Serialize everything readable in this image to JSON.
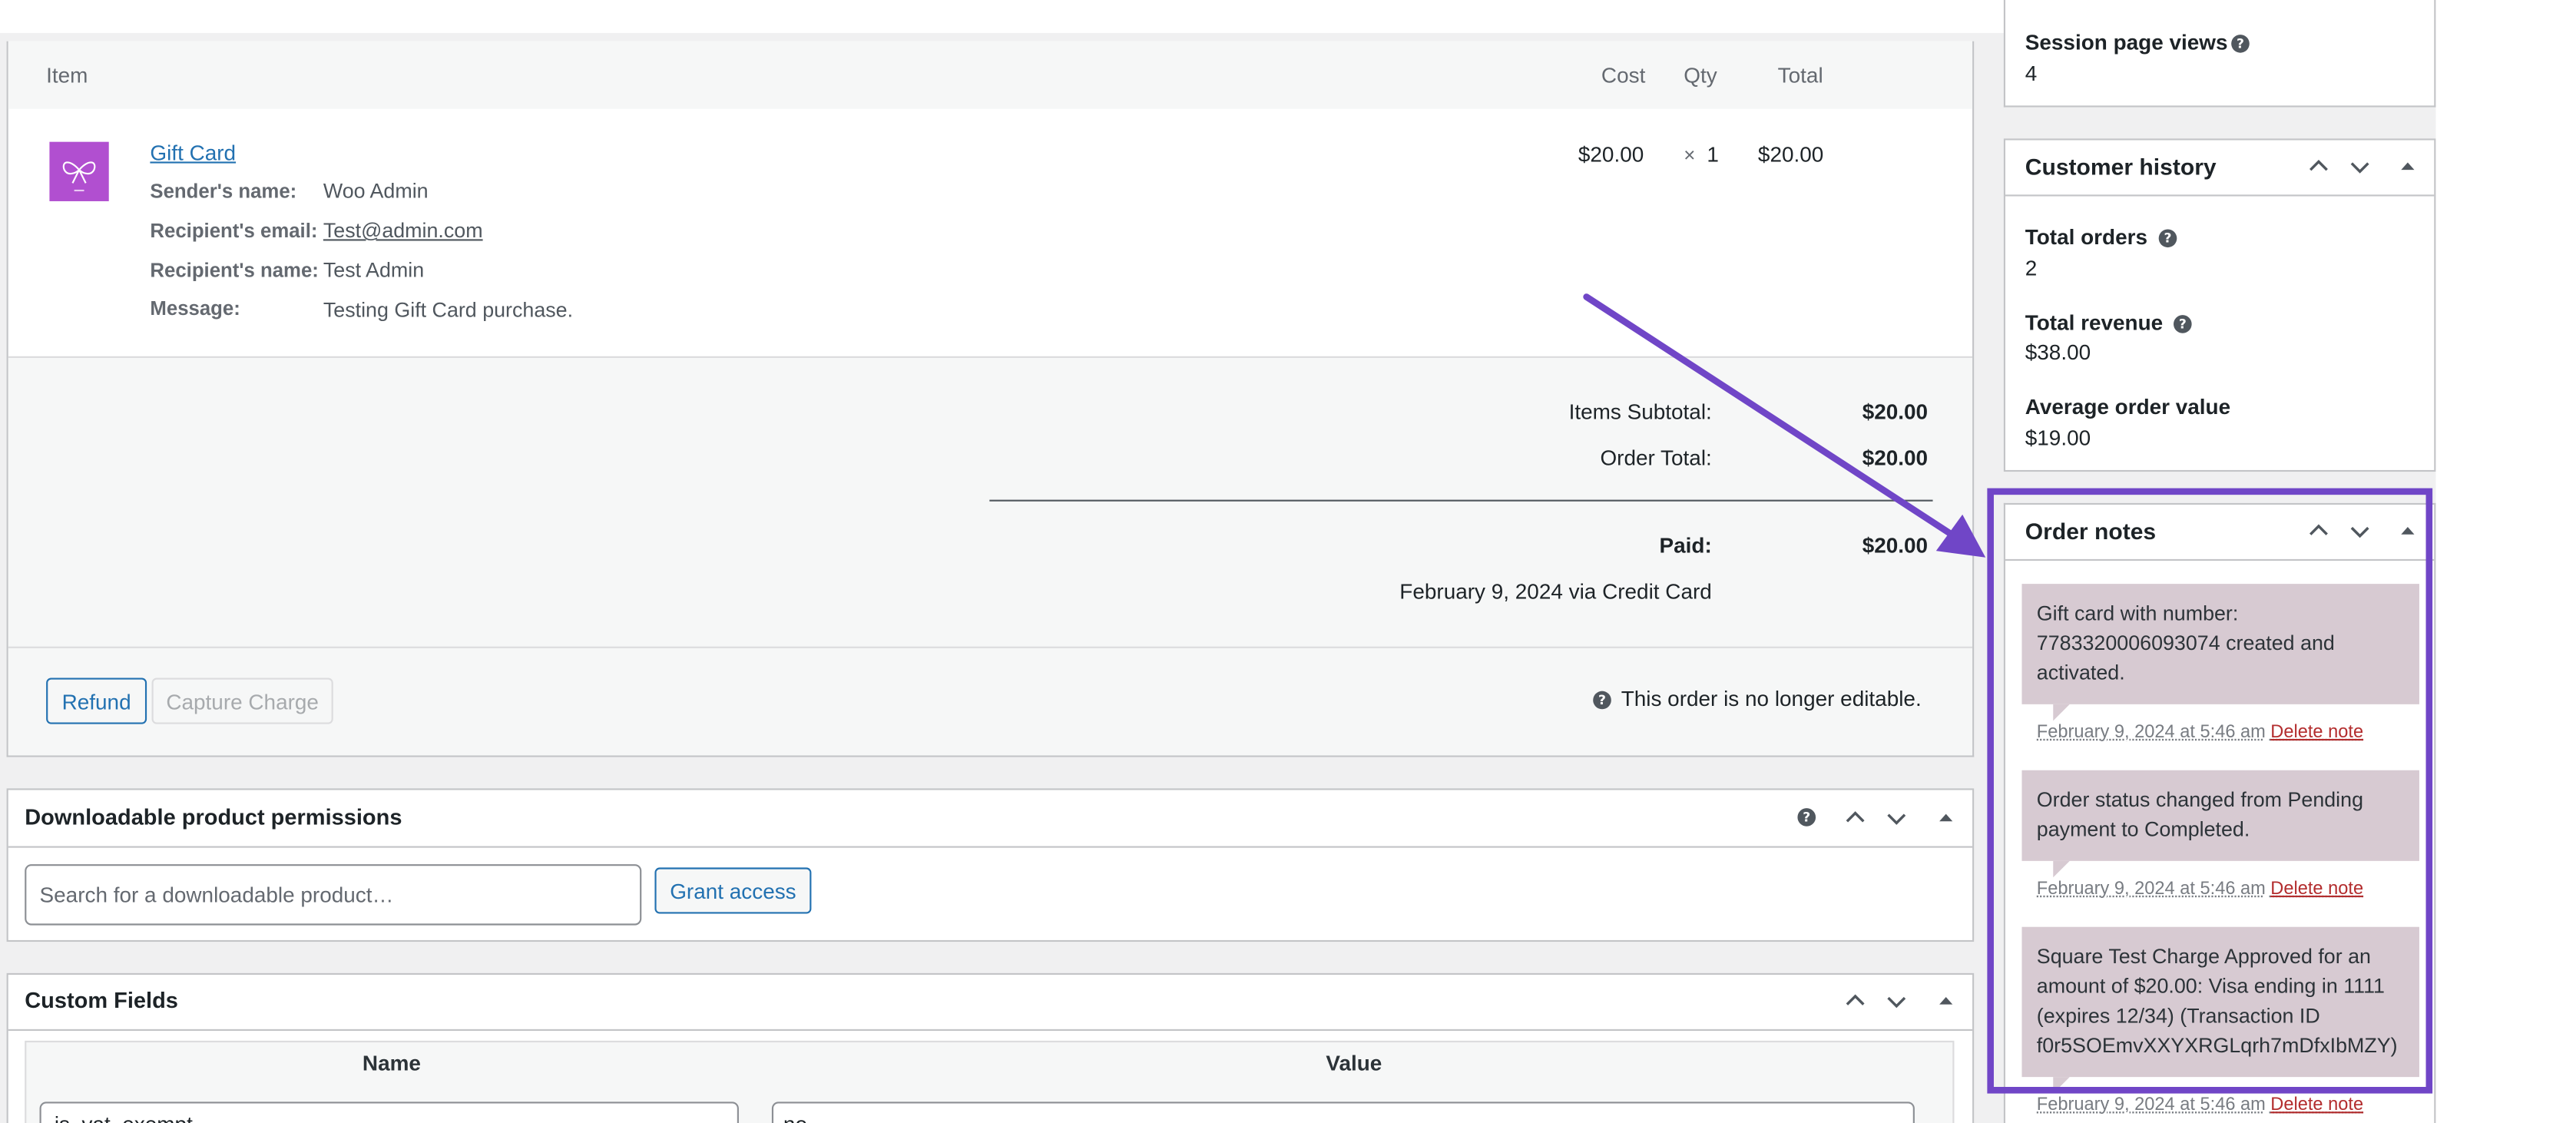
{
  "items_table": {
    "headers": {
      "item": "Item",
      "cost": "Cost",
      "qty": "Qty",
      "total": "Total"
    },
    "line_item": {
      "name": "Gift Card",
      "cost": "$20.00",
      "qty_symbol": "×",
      "qty": "1",
      "total": "$20.00",
      "meta": [
        {
          "label": "Sender's name:",
          "value": "Woo Admin"
        },
        {
          "label": "Recipient's email:",
          "value": "Test@admin.com"
        },
        {
          "label": "Recipient's name:",
          "value": "Test Admin"
        },
        {
          "label": "Message:",
          "value": "Testing Gift Card purchase."
        }
      ]
    },
    "totals": {
      "subtotal_label": "Items Subtotal:",
      "subtotal_value": "$20.00",
      "order_total_label": "Order Total:",
      "order_total_value": "$20.00",
      "paid_label": "Paid:",
      "paid_value": "$20.00",
      "paid_note": "February 9, 2024 via Credit Card"
    },
    "actions": {
      "refund": "Refund",
      "capture": "Capture Charge",
      "not_editable": "This order is no longer editable."
    }
  },
  "downloadable": {
    "title": "Downloadable product permissions",
    "search_placeholder": "Search for a downloadable product…",
    "grant_access": "Grant access"
  },
  "custom_fields": {
    "title": "Custom Fields",
    "col_name": "Name",
    "col_value": "Value",
    "row_name": "is_vat_exempt",
    "row_value": "no"
  },
  "sidebar": {
    "session": {
      "label": "Session page views",
      "value": "4"
    },
    "customer_history": {
      "title": "Customer history",
      "total_orders_label": "Total orders",
      "total_orders_value": "2",
      "total_revenue_label": "Total revenue",
      "total_revenue_value": "$38.00",
      "avg_label": "Average order value",
      "avg_value": "$19.00"
    },
    "order_notes": {
      "title": "Order notes",
      "notes": [
        {
          "text": "Gift card with number: 7783320006093074 created and activated.",
          "date": "February 9, 2024 at 5:46 am",
          "delete": "Delete note"
        },
        {
          "text": "Order status changed from Pending payment to Completed.",
          "date": "February 9, 2024 at 5:46 am",
          "delete": "Delete note"
        },
        {
          "text": "Square Test Charge Approved for an amount of $20.00: Visa ending in 1111 (expires 12/34) (Transaction ID f0r5SOEmvXXYXRGLqrh7mDfxIbMZY)",
          "date": "February 9, 2024 at 5:46 am",
          "delete": "Delete note"
        }
      ]
    }
  },
  "colors": {
    "highlight": "#7046c7",
    "note_bg": "#d7cad2",
    "link": "#2271b1",
    "delete": "#b32d2e"
  }
}
